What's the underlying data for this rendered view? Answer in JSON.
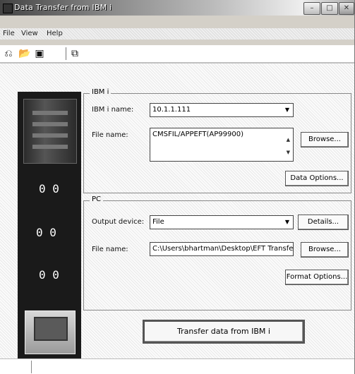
{
  "window": {
    "title": "Data Transfer from IBM i"
  },
  "menu": [
    "File",
    "View",
    "Help"
  ],
  "toolbar": {
    "icons": [
      "new-transfer-icon",
      "open-icon",
      "save-icon",
      "properties-icon"
    ]
  },
  "ibmi": {
    "group_label": "IBM i",
    "ibmi_name_label": "IBM i name:",
    "ibmi_name_value": "10.1.1.111",
    "file_name_label": "File name:",
    "file_name_value": "CMSFIL/APPEFT(AP99900)",
    "browse_label": "Browse...",
    "data_options_label": "Data Options..."
  },
  "pc": {
    "group_label": "PC",
    "output_device_label": "Output device:",
    "output_device_value": "File",
    "details_label": "Details...",
    "file_name_label": "File name:",
    "file_name_value": "C:\\Users\\bhartman\\Desktop\\EFT Transfer.FC",
    "browse_label": "Browse...",
    "format_options_label": "Format Options..."
  },
  "transfer_button": "Transfer data from IBM i"
}
